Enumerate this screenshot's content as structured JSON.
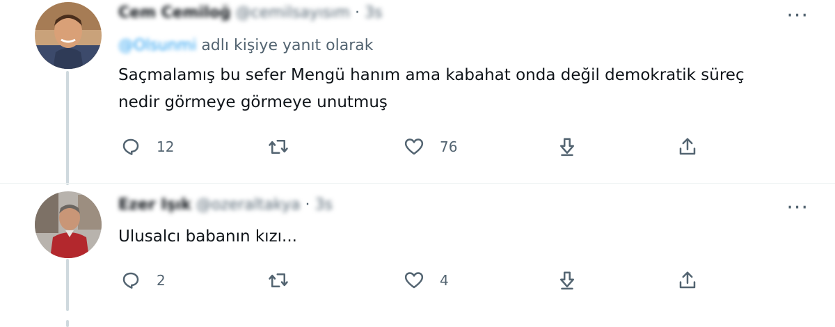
{
  "tweets": [
    {
      "name": "Cem Cemiloğ",
      "handle": "@cemilsayısım",
      "sep": "·",
      "time": "3s",
      "reply_mention": "@Olsunmi",
      "reply_suffix": "adlı kişiye yanıt olarak",
      "text": "Saçmalamış bu sefer Mengü hanım ama kabahat onda değil demokratik süreç nedir görmeye görmeye unutmuş",
      "more_label": "···",
      "reply_count": "12",
      "retweet_count": "",
      "like_count": "76"
    },
    {
      "name": "Ezer Işık",
      "handle": "@ozeraltakya",
      "sep": "·",
      "time": "3s",
      "text": "Ulusalcı babanın kızı...",
      "more_label": "···",
      "reply_count": "2",
      "retweet_count": "",
      "like_count": "4"
    }
  ],
  "icons": {
    "reply": "reply-icon",
    "retweet": "retweet-icon",
    "like": "like-icon",
    "download": "download-icon",
    "share": "share-icon",
    "more": "more-icon"
  },
  "colors": {
    "link": "#1d9bf0",
    "secondary": "#536471",
    "thread_line": "#cfd9de"
  }
}
